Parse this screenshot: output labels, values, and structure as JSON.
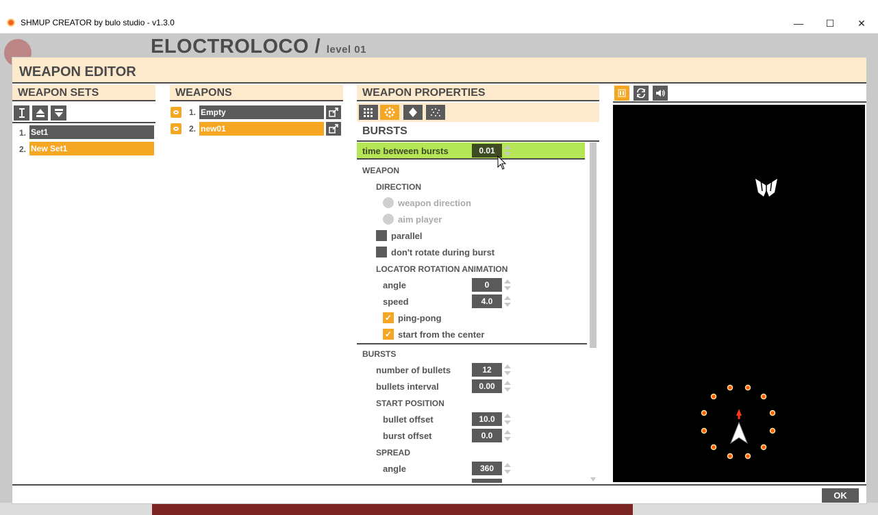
{
  "window": {
    "title": "SHMUP CREATOR by bulo studio - v1.3.0",
    "minimize": "—",
    "maximize": "☐",
    "close": "✕"
  },
  "background": {
    "project": "ELOCTROLOCO /",
    "level": "level 01"
  },
  "editor": {
    "title": "WEAPON EDITOR",
    "ok_label": "OK"
  },
  "weapon_sets": {
    "title": "WEAPON SETS",
    "toolbar_icons": [
      "rename-icon",
      "move-up-icon",
      "move-down-icon"
    ],
    "items": [
      {
        "num": "1.",
        "name": "Set1",
        "selected": false
      },
      {
        "num": "2.",
        "name": "New Set1",
        "selected": true
      }
    ]
  },
  "weapons": {
    "title": "WEAPONS",
    "items": [
      {
        "num": "1.",
        "name": "Empty",
        "selected": false
      },
      {
        "num": "2.",
        "name": "new01",
        "selected": true
      }
    ]
  },
  "properties": {
    "title": "WEAPON PROPERTIES",
    "tabs": [
      "grid-icon",
      "burst-icon",
      "diamond-icon",
      "scatter-icon"
    ],
    "active_tab": 1,
    "section_title": "BURSTS",
    "highlight": {
      "label": "time between bursts",
      "value": "0.01"
    },
    "weapon_label": "WEAPON",
    "direction_label": "DIRECTION",
    "weapon_direction": "weapon direction",
    "aim_player": "aim player",
    "parallel": "parallel",
    "no_rotate": "don't rotate during burst",
    "locator_label": "LOCATOR ROTATION ANIMATION",
    "angle_label": "angle",
    "angle_value": "0",
    "speed_label": "speed",
    "speed_value": "4.0",
    "ping_pong": "ping-pong",
    "start_center": "start from the center",
    "bursts_label": "BURSTS",
    "num_bullets_label": "number of bullets",
    "num_bullets_value": "12",
    "interval_label": "bullets interval",
    "interval_value": "0.00",
    "start_pos_label": "START POSITION",
    "bullet_offset_label": "bullet offset",
    "bullet_offset_value": "10.0",
    "burst_offset_label": "burst offset",
    "burst_offset_value": "0.0",
    "spread_label": "SPREAD",
    "spread_angle_label": "angle",
    "spread_angle_value": "360"
  },
  "preview": {
    "buttons": [
      "pause-icon",
      "refresh-icon",
      "sound-icon"
    ]
  },
  "colors": {
    "accent": "#f5a623",
    "header_bg": "#fdeacc",
    "highlight": "#b5e655",
    "dark": "#5a5a5a"
  }
}
